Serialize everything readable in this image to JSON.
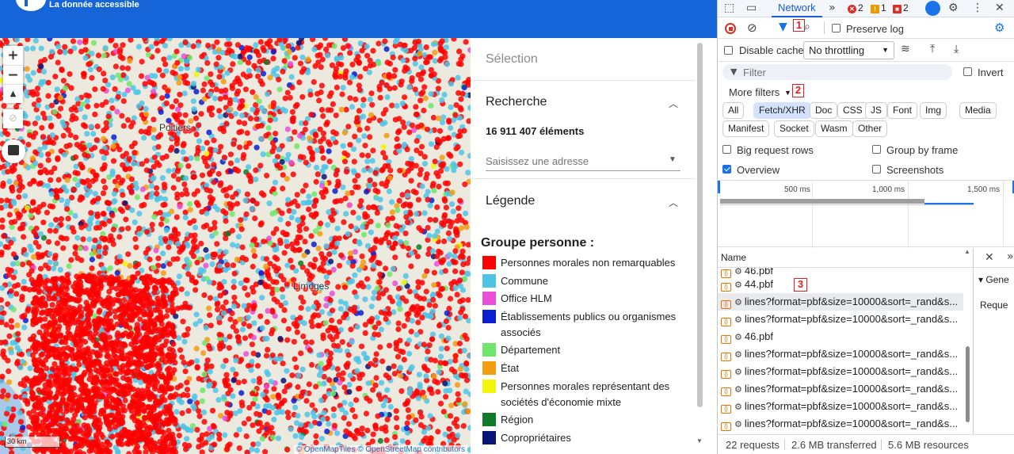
{
  "app": {
    "tagline": "La donnée accessible",
    "accent": "#1565d8"
  },
  "map": {
    "zoom_in": "+",
    "zoom_out": "−",
    "compass": "▲",
    "cities": [
      "Poitiers",
      "Limoges"
    ],
    "scale_label": "30 km",
    "attribution": "© OpenMapTiles © OpenStreetMap contributors"
  },
  "side": {
    "selection_title": "Sélection",
    "search_title": "Recherche",
    "count": "16 911 407 éléments",
    "address_placeholder": "Saisissez une adresse",
    "legend_title": "Légende",
    "group_title": "Groupe personne :",
    "legend": [
      {
        "label": "Personnes morales non remarquables",
        "color": "#ff0000"
      },
      {
        "label": "Commune",
        "color": "#4fc3e6"
      },
      {
        "label": "Office HLM",
        "color": "#e94fd8"
      },
      {
        "label": "Établissements publics ou organismes associés",
        "color": "#0a1fcf"
      },
      {
        "label": "Département",
        "color": "#6ee66a"
      },
      {
        "label": "État",
        "color": "#f39c12"
      },
      {
        "label": "Personnes morales représentant des sociétés d'économie mixte",
        "color": "#f5f50a"
      },
      {
        "label": "Région",
        "color": "#0f7a2a"
      },
      {
        "label": "Copropriétaires",
        "color": "#0a1478"
      }
    ]
  },
  "devtools": {
    "tab": "Network",
    "badges": {
      "errors": "2",
      "warnings": "1",
      "issues": "2"
    },
    "preserve_log": "Preserve log",
    "disable_cache": "Disable cache",
    "throttling": "No throttling",
    "filter_placeholder": "Filter",
    "invert": "Invert",
    "more_filters": "More filters",
    "annotations": [
      "1",
      "2",
      "3"
    ],
    "types": [
      "All",
      "Fetch/XHR",
      "Doc",
      "CSS",
      "JS",
      "Font",
      "Img",
      "Media",
      "Manifest",
      "Socket",
      "Wasm",
      "Other"
    ],
    "selected_type": "Fetch/XHR",
    "options": {
      "big_rows": "Big request rows",
      "group_frame": "Group by frame",
      "overview": "Overview",
      "screenshots": "Screenshots"
    },
    "timeline_ticks": [
      "500 ms",
      "1,000 ms",
      "1,500 ms"
    ],
    "name_header": "Name",
    "requests": [
      "46.pbf",
      "44.pbf",
      "lines?format=pbf&size=10000&sort=_rand&s...",
      "lines?format=pbf&size=10000&sort=_rand&s...",
      "46.pbf",
      "lines?format=pbf&size=10000&sort=_rand&s...",
      "lines?format=pbf&size=10000&sort=_rand&s...",
      "lines?format=pbf&size=10000&sort=_rand&s...",
      "lines?format=pbf&size=10000&sort=_rand&s...",
      "lines?format=pbf&size=10000&sort=_rand&s..."
    ],
    "detail_tab": "Gene",
    "detail_label": "Reque",
    "status": {
      "requests": "22 requests",
      "transferred": "2.6 MB transferred",
      "resources": "5.6 MB resources"
    }
  }
}
